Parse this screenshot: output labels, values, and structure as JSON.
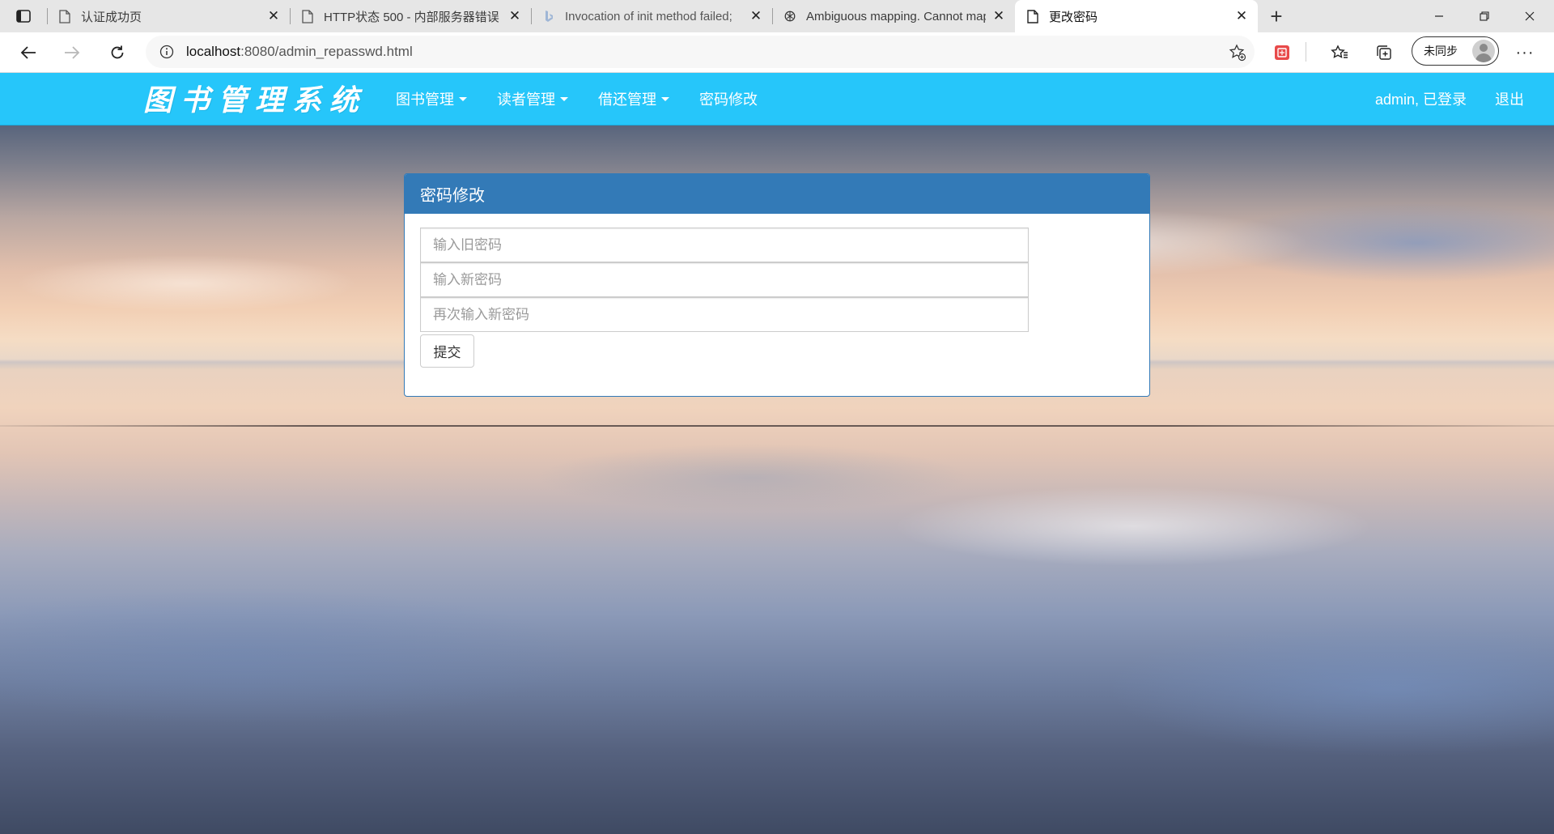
{
  "browser": {
    "tabs": [
      {
        "title": "认证成功页",
        "favicon": "page-icon",
        "active": false
      },
      {
        "title": "HTTP状态 500 - 内部服务器错误",
        "favicon": "page-icon",
        "active": false
      },
      {
        "title": "Invocation of init method failed;",
        "favicon": "bing-icon",
        "active": false
      },
      {
        "title": "Ambiguous mapping. Cannot map",
        "favicon": "chatgpt-icon",
        "active": false
      },
      {
        "title": "更改密码",
        "favicon": "page-icon",
        "active": true
      }
    ],
    "address": {
      "host": "localhost",
      "path": ":8080/admin_repasswd.html"
    },
    "profile_label": "未同步",
    "more_label": "···"
  },
  "app": {
    "brand": "图书管理系统",
    "nav": {
      "book_mgmt": "图书管理",
      "reader_mgmt": "读者管理",
      "borrow_mgmt": "借还管理",
      "change_pwd": "密码修改"
    },
    "user_status": "admin, 已登录",
    "logout": "退出"
  },
  "panel": {
    "title": "密码修改",
    "old_password_placeholder": "输入旧密码",
    "new_password_placeholder": "输入新密码",
    "confirm_password_placeholder": "再次输入新密码",
    "submit_label": "提交"
  },
  "colors": {
    "navbar": "#26c6fa",
    "panel_heading": "#337ab7"
  }
}
